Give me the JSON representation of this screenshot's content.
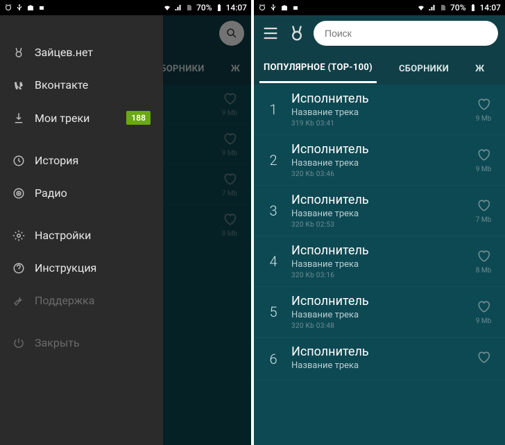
{
  "status": {
    "battery": "70%",
    "time": "14:07"
  },
  "search": {
    "placeholder": "Поиск"
  },
  "tabs": {
    "popular": "ПОПУЛЯРНОЕ (TOP-100)",
    "collections": "СБОРНИКИ",
    "collections_partial": "СБОРНИКИ",
    "extra": "Ж"
  },
  "drawer": {
    "zaycev": "Зайцев.нет",
    "vk": "Вконтакте",
    "mytracks": "Мои треки",
    "mytracks_badge": "188",
    "history": "История",
    "radio": "Радио",
    "settings": "Настройки",
    "help": "Инструкция",
    "support": "Поддержка",
    "close": "Закрыть"
  },
  "tracks": [
    {
      "idx": "1",
      "artist": "Исполнитель",
      "title": "Название трека",
      "meta": "319 Kb  03:41",
      "size": "9 Mb"
    },
    {
      "idx": "2",
      "artist": "Исполнитель",
      "title": "Название трека",
      "meta": "320 Kb  03:46",
      "size": "9 Mb"
    },
    {
      "idx": "3",
      "artist": "Исполнитель",
      "title": "Название трека",
      "meta": "320 Kb  02:53",
      "size": "7 Mb"
    },
    {
      "idx": "4",
      "artist": "Исполнитель",
      "title": "Название трека",
      "meta": "320 Kb  03:16",
      "size": "8 Mb"
    },
    {
      "idx": "5",
      "artist": "Исполнитель",
      "title": "Название трека",
      "meta": "320 Kb  03:48",
      "size": "9 Mb"
    },
    {
      "idx": "6",
      "artist": "Исполнитель",
      "title": "Название трека",
      "meta": "",
      "size": ""
    }
  ],
  "left_partial_tracks": [
    {
      "size": "9 Mb"
    },
    {
      "size": "9 Mb"
    },
    {
      "size": "7 Mb"
    },
    {
      "size": "8 Mb"
    }
  ]
}
